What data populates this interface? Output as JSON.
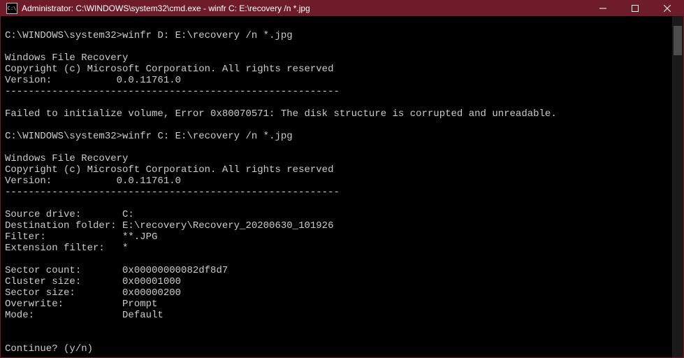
{
  "titlebar": {
    "title": "Administrator: C:\\WINDOWS\\system32\\cmd.exe - winfr  C: E:\\recovery /n *.jpg"
  },
  "terminal": {
    "line1_prompt": "C:\\WINDOWS\\system32>",
    "line1_cmd": "winfr D: E:\\recovery /n *.jpg",
    "block1_name": "Windows File Recovery",
    "block1_copy": "Copyright (c) Microsoft Corporation. All rights reserved",
    "block1_ver": "Version:           0.0.11761.0",
    "dashes": "---------------------------------------------------------",
    "error_line": "Failed to initialize volume, Error 0x80070571: The disk structure is corrupted and unreadable.",
    "line2_prompt": "C:\\WINDOWS\\system32>",
    "line2_cmd": "winfr C: E:\\recovery /n *.jpg",
    "block2_name": "Windows File Recovery",
    "block2_copy": "Copyright (c) Microsoft Corporation. All rights reserved",
    "block2_ver": "Version:           0.0.11761.0",
    "info_source": "Source drive:       C:",
    "info_dest": "Destination folder: E:\\recovery\\Recovery_20200630_101926",
    "info_filter": "Filter:             **.JPG",
    "info_ext": "Extension filter:   *",
    "info_sector_count": "Sector count:       0x00000000082df8d7",
    "info_cluster": "Cluster size:       0x00001000",
    "info_sector_size": "Sector size:        0x00000200",
    "info_overwrite": "Overwrite:          Prompt",
    "info_mode": "Mode:               Default",
    "continue_prompt": "Continue? (y/n) "
  }
}
